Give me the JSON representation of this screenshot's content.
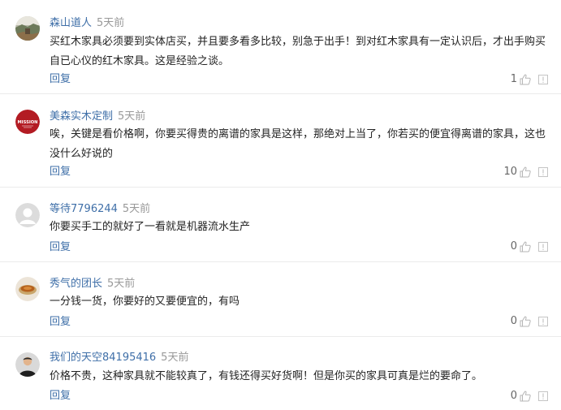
{
  "comments": [
    {
      "user": "森山道人",
      "time": "5天前",
      "text": "买红木家具必须要到实体店买，并且要多看多比较，别急于出手！到对红木家具有一定认识后，才出手购买自已心仪的红木家具。这是经验之谈。",
      "reply": "回复",
      "likes": "1",
      "avatar_style": "landscape"
    },
    {
      "user": "美森实木定制",
      "time": "5天前",
      "text": "唉，关键是看价格啊，你要买得贵的离谱的家具是这样，那绝对上当了，你若买的便宜得离谱的家具，这也没什么好说的",
      "reply": "回复",
      "likes": "10",
      "avatar_style": "logo",
      "avatar_logo_text": "MISSION"
    },
    {
      "user": "等待7796244",
      "time": "5天前",
      "text": "你要买手工的就好了一看就是机器流水生产",
      "reply": "回复",
      "likes": "0",
      "avatar_style": "default"
    },
    {
      "user": "秀气的团长",
      "time": "5天前",
      "text": "一分钱一货，你要好的又要便宜的，有吗",
      "reply": "回复",
      "likes": "0",
      "avatar_style": "bowl"
    },
    {
      "user": "我们的天空84195416",
      "time": "5天前",
      "text": "价格不贵，这种家具就不能较真了，有钱还得买好货啊！但是你买的家具可真是烂的要命了。",
      "reply": "回复",
      "likes": "0",
      "avatar_style": "person"
    }
  ],
  "colors": {
    "username": "#3f6fa8",
    "time": "#999999",
    "reply": "#3f6fa8",
    "divider": "#ebebeb"
  },
  "icons": {
    "like": "thumbs-up-icon",
    "report": "report-icon"
  }
}
